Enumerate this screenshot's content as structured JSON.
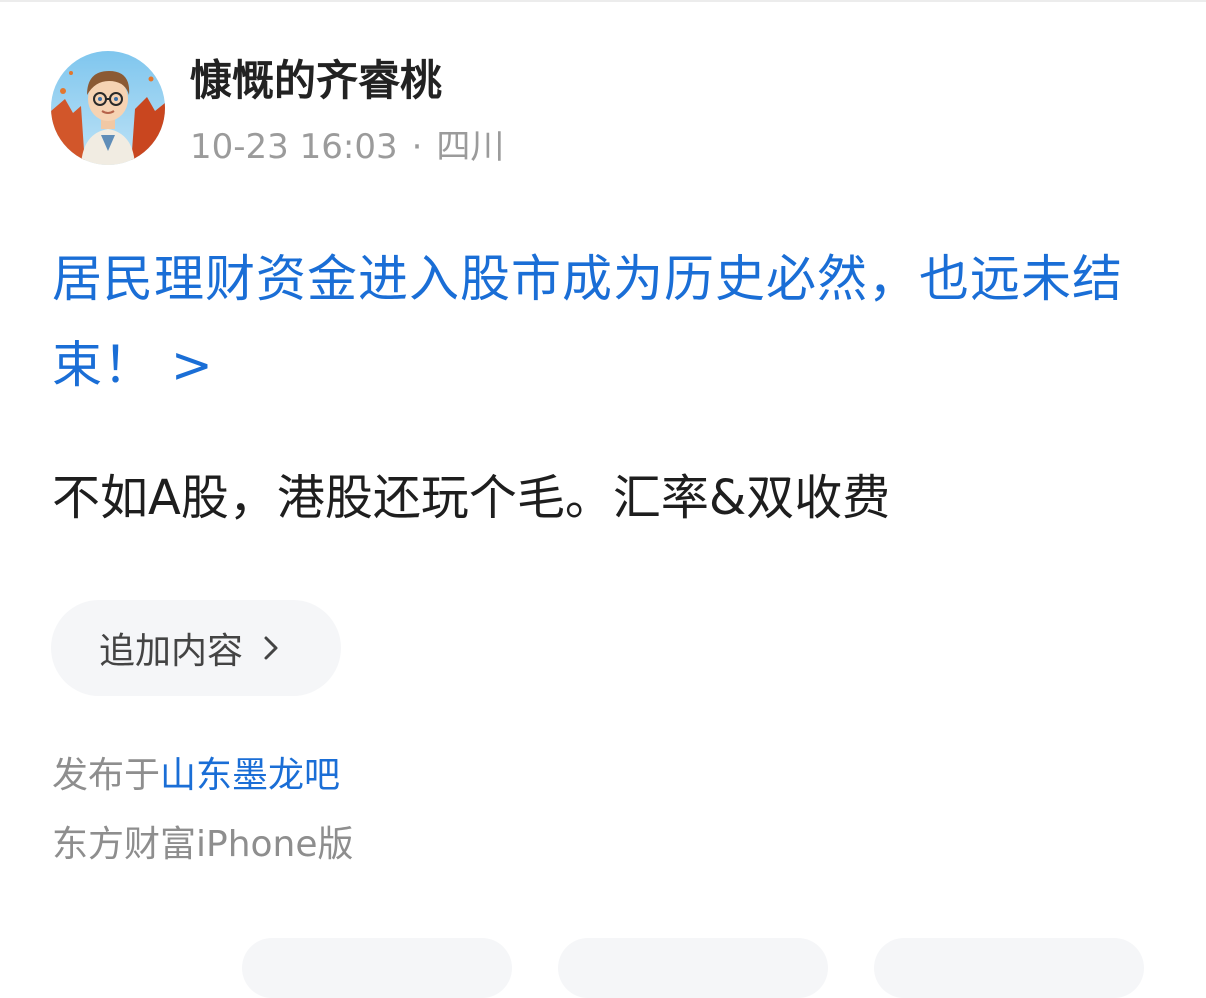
{
  "post": {
    "author": {
      "name": "慷慨的齐睿桃",
      "time": "10-23 16:03",
      "separator": "·",
      "location": "四川"
    },
    "title_link": "居民理财资金进入股市成为历史必然，也远未结束！ >",
    "body": "不如A股，港股还玩个毛。汇率&双收费",
    "append_button_label": "追加内容",
    "published_prefix": "发布于",
    "forum_name": "山东墨龙吧",
    "client": "东方财富iPhone版"
  },
  "icons": {
    "avatar": "avatar-cartoon-boy",
    "append_chevron": "chevron-right-icon"
  },
  "colors": {
    "link": "#1a6ed6",
    "text": "#1e1e1e",
    "muted": "#9b9b9b",
    "pill_bg": "#f5f6f8"
  }
}
